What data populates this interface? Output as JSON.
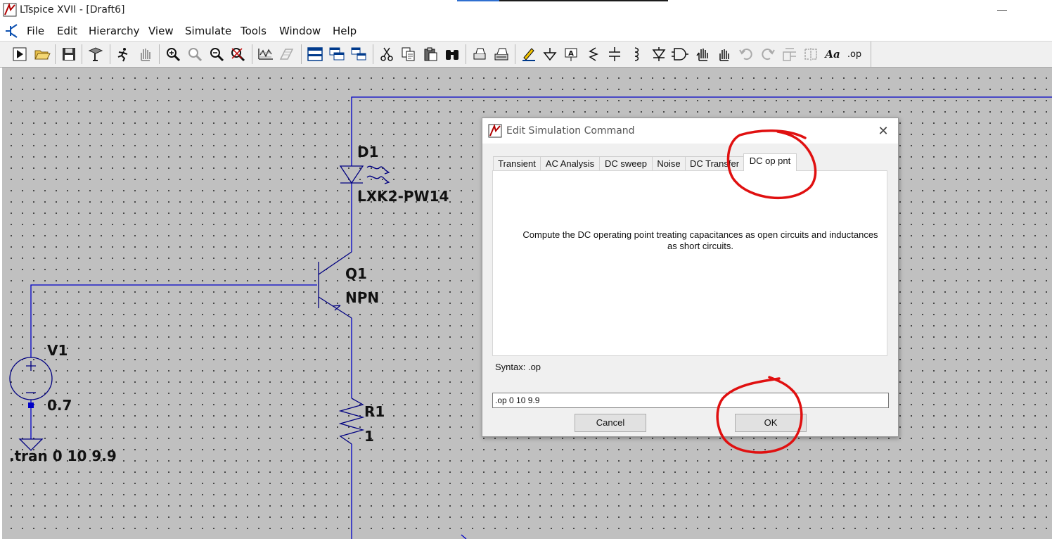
{
  "window": {
    "title": "LTspice XVII - [Draft6]",
    "minimize_glyph": "—"
  },
  "menu": {
    "items": [
      {
        "label": "File",
        "name": "menu-file"
      },
      {
        "label": "Edit",
        "name": "menu-edit"
      },
      {
        "label": "Hierarchy",
        "name": "menu-hierarchy"
      },
      {
        "label": "View",
        "name": "menu-view"
      },
      {
        "label": "Simulate",
        "name": "menu-simulate"
      },
      {
        "label": "Tools",
        "name": "menu-tools"
      },
      {
        "label": "Window",
        "name": "menu-window"
      },
      {
        "label": "Help",
        "name": "menu-help"
      }
    ]
  },
  "toolbar": {
    "text_tool": "Aa",
    "op_tool": ".op"
  },
  "schematic": {
    "d1_ref": "D1",
    "d1_value": "LXK2-PW14",
    "q1_ref": "Q1",
    "q1_value": "NPN",
    "v1_ref": "V1",
    "v1_value": "0.7",
    "r1_ref": "R1",
    "r1_value": "1",
    "directive": ".tran 0 10 9.9",
    "colors": {
      "wire": "#0000c8",
      "component": "#000080",
      "background": "#c0c0c0"
    }
  },
  "dialog": {
    "title": "Edit Simulation Command",
    "close_glyph": "✕",
    "tabs": [
      {
        "label": "Transient",
        "active": false
      },
      {
        "label": "AC Analysis",
        "active": false
      },
      {
        "label": "DC sweep",
        "active": false
      },
      {
        "label": "Noise",
        "active": false
      },
      {
        "label": "DC Transfer",
        "active": false
      },
      {
        "label": "DC op pnt",
        "active": true
      }
    ],
    "description": "Compute the DC operating point treating capacitances as open circuits and inductances as short circuits.",
    "syntax": "Syntax: .op",
    "command_value": ".op 0 10 9.9",
    "cancel_label": "Cancel",
    "ok_label": "OK"
  },
  "annotation_color": "#e01010"
}
